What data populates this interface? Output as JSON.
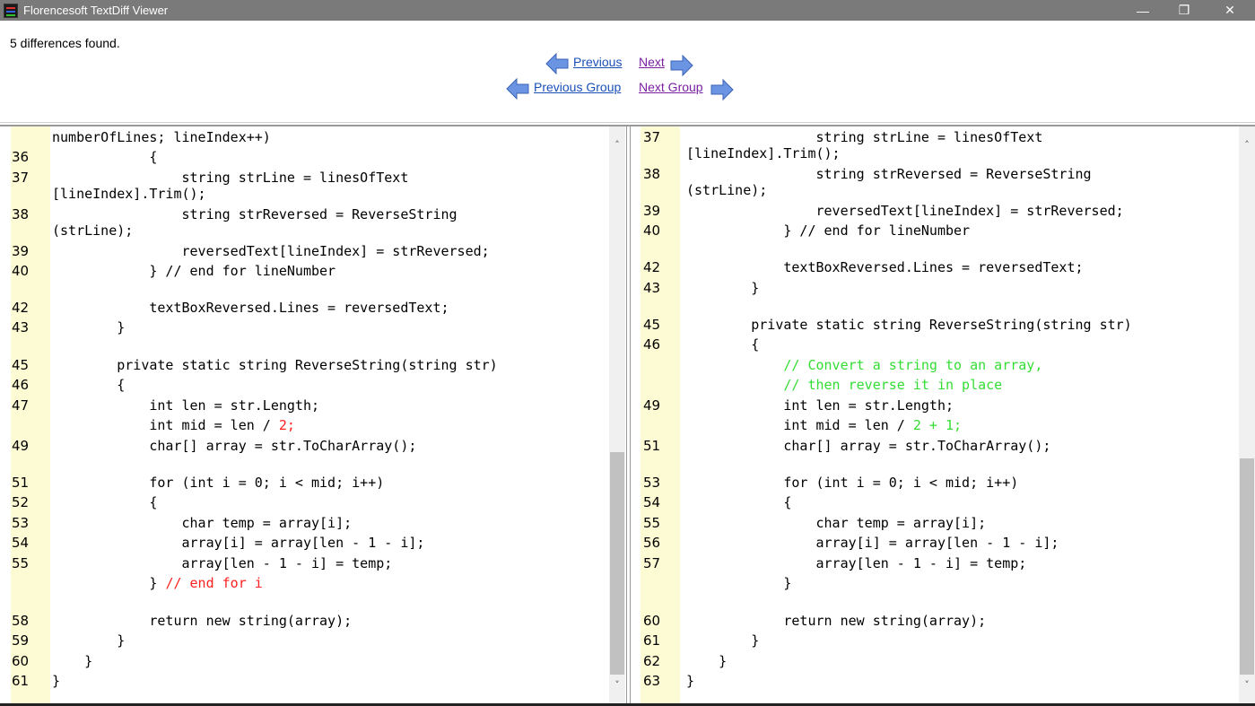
{
  "window": {
    "title": "Florencesoft TextDiff Viewer",
    "minimize": "—",
    "maximize": "❐",
    "close": "✕"
  },
  "status": "5 differences found.",
  "nav": {
    "previous": "Previous",
    "next": "Next",
    "previous_group": "Previous Group",
    "next_group": "Next Group"
  },
  "colors": {
    "gutter": "#fdfbd3",
    "changed": "#ff2020",
    "added": "#33dd33",
    "link": "#1a4fb8",
    "visited_link": "#7a1fa2",
    "arrow": "#5a86d8"
  },
  "left_pane": {
    "rows": [
      {
        "ln": "",
        "segs": [
          {
            "t": "numberOfLines; lineIndex++)",
            "c": ""
          }
        ]
      },
      {
        "ln": "36",
        "segs": [
          {
            "t": "            {",
            "c": ""
          }
        ]
      },
      {
        "ln": "37",
        "segs": [
          {
            "t": "                string strLine = linesOfText",
            "c": ""
          }
        ]
      },
      {
        "ln": "",
        "segs": [
          {
            "t": "[lineIndex].Trim();",
            "c": ""
          }
        ]
      },
      {
        "ln": "38",
        "segs": [
          {
            "t": "                string strReversed = ReverseString",
            "c": ""
          }
        ]
      },
      {
        "ln": "",
        "segs": [
          {
            "t": "(strLine);",
            "c": ""
          }
        ]
      },
      {
        "ln": "39",
        "segs": [
          {
            "t": "                reversedText[lineIndex] = strReversed;",
            "c": ""
          }
        ]
      },
      {
        "ln": "40",
        "segs": [
          {
            "t": "            } // end for lineNumber",
            "c": ""
          }
        ]
      },
      {
        "ln": "",
        "segs": []
      },
      {
        "ln": "42",
        "segs": [
          {
            "t": "            textBoxReversed.Lines = reversedText;",
            "c": ""
          }
        ]
      },
      {
        "ln": "43",
        "segs": [
          {
            "t": "        }",
            "c": ""
          }
        ]
      },
      {
        "ln": "",
        "segs": []
      },
      {
        "ln": "45",
        "segs": [
          {
            "t": "        private static string ReverseString(string str)",
            "c": ""
          }
        ]
      },
      {
        "ln": "46",
        "segs": [
          {
            "t": "        {",
            "c": ""
          }
        ]
      },
      {
        "ln": "47",
        "segs": [
          {
            "t": "            int len = str.Length;",
            "c": ""
          }
        ]
      },
      {
        "ln": "",
        "segs": [
          {
            "t": "            int mid = len / ",
            "c": ""
          },
          {
            "t": "2;",
            "c": "red"
          }
        ]
      },
      {
        "ln": "49",
        "segs": [
          {
            "t": "            char[] array = str.ToCharArray();",
            "c": ""
          }
        ]
      },
      {
        "ln": "",
        "segs": []
      },
      {
        "ln": "51",
        "segs": [
          {
            "t": "            for (int i = 0; i < mid; i++)",
            "c": ""
          }
        ]
      },
      {
        "ln": "52",
        "segs": [
          {
            "t": "            {",
            "c": ""
          }
        ]
      },
      {
        "ln": "53",
        "segs": [
          {
            "t": "                char temp = array[i];",
            "c": ""
          }
        ]
      },
      {
        "ln": "54",
        "segs": [
          {
            "t": "                array[i] = array[len - 1 - i];",
            "c": ""
          }
        ]
      },
      {
        "ln": "55",
        "segs": [
          {
            "t": "                array[len - 1 - i] = temp;",
            "c": ""
          }
        ]
      },
      {
        "ln": "",
        "segs": [
          {
            "t": "            } ",
            "c": ""
          },
          {
            "t": "// end for i",
            "c": "red"
          }
        ]
      },
      {
        "ln": "",
        "segs": []
      },
      {
        "ln": "58",
        "segs": [
          {
            "t": "            return new string(array);",
            "c": ""
          }
        ]
      },
      {
        "ln": "59",
        "segs": [
          {
            "t": "        }",
            "c": ""
          }
        ]
      },
      {
        "ln": "60",
        "segs": [
          {
            "t": "    }",
            "c": ""
          }
        ]
      },
      {
        "ln": "61",
        "segs": [
          {
            "t": "}",
            "c": ""
          }
        ]
      }
    ]
  },
  "right_pane": {
    "rows": [
      {
        "ln": "37",
        "segs": [
          {
            "t": "                string strLine = linesOfText",
            "c": ""
          }
        ]
      },
      {
        "ln": "",
        "segs": [
          {
            "t": "[lineIndex].Trim();",
            "c": ""
          }
        ]
      },
      {
        "ln": "38",
        "segs": [
          {
            "t": "                string strReversed = ReverseString",
            "c": ""
          }
        ]
      },
      {
        "ln": "",
        "segs": [
          {
            "t": "(strLine);",
            "c": ""
          }
        ]
      },
      {
        "ln": "39",
        "segs": [
          {
            "t": "                reversedText[lineIndex] = strReversed;",
            "c": ""
          }
        ]
      },
      {
        "ln": "40",
        "segs": [
          {
            "t": "            } // end for lineNumber",
            "c": ""
          }
        ]
      },
      {
        "ln": "",
        "segs": []
      },
      {
        "ln": "42",
        "segs": [
          {
            "t": "            textBoxReversed.Lines = reversedText;",
            "c": ""
          }
        ]
      },
      {
        "ln": "43",
        "segs": [
          {
            "t": "        }",
            "c": ""
          }
        ]
      },
      {
        "ln": "",
        "segs": []
      },
      {
        "ln": "45",
        "segs": [
          {
            "t": "        private static string ReverseString(string str)",
            "c": ""
          }
        ]
      },
      {
        "ln": "46",
        "segs": [
          {
            "t": "        {",
            "c": ""
          }
        ]
      },
      {
        "ln": "",
        "segs": [
          {
            "t": "            ",
            "c": ""
          },
          {
            "t": "// Convert a string to an array,",
            "c": "green"
          }
        ]
      },
      {
        "ln": "",
        "segs": [
          {
            "t": "            ",
            "c": ""
          },
          {
            "t": "// then reverse it in place",
            "c": "green"
          }
        ]
      },
      {
        "ln": "49",
        "segs": [
          {
            "t": "            int len = str.Length;",
            "c": ""
          }
        ]
      },
      {
        "ln": "",
        "segs": [
          {
            "t": "            int mid = len / ",
            "c": ""
          },
          {
            "t": "2 + 1;",
            "c": "green"
          }
        ]
      },
      {
        "ln": "51",
        "segs": [
          {
            "t": "            char[] array = str.ToCharArray();",
            "c": ""
          }
        ]
      },
      {
        "ln": "",
        "segs": []
      },
      {
        "ln": "53",
        "segs": [
          {
            "t": "            for (int i = 0; i < mid; i++)",
            "c": ""
          }
        ]
      },
      {
        "ln": "54",
        "segs": [
          {
            "t": "            {",
            "c": ""
          }
        ]
      },
      {
        "ln": "55",
        "segs": [
          {
            "t": "                char temp = array[i];",
            "c": ""
          }
        ]
      },
      {
        "ln": "56",
        "segs": [
          {
            "t": "                array[i] = array[len - 1 - i];",
            "c": ""
          }
        ]
      },
      {
        "ln": "57",
        "segs": [
          {
            "t": "                array[len - 1 - i] = temp;",
            "c": ""
          }
        ]
      },
      {
        "ln": "",
        "segs": [
          {
            "t": "            }",
            "c": ""
          }
        ]
      },
      {
        "ln": "",
        "segs": []
      },
      {
        "ln": "60",
        "segs": [
          {
            "t": "            return new string(array);",
            "c": ""
          }
        ]
      },
      {
        "ln": "61",
        "segs": [
          {
            "t": "        }",
            "c": ""
          }
        ]
      },
      {
        "ln": "62",
        "segs": [
          {
            "t": "    }",
            "c": ""
          }
        ]
      },
      {
        "ln": "63",
        "segs": [
          {
            "t": "}",
            "c": ""
          }
        ]
      }
    ]
  },
  "scrollbar": {
    "up": "˄",
    "down": "˅"
  }
}
